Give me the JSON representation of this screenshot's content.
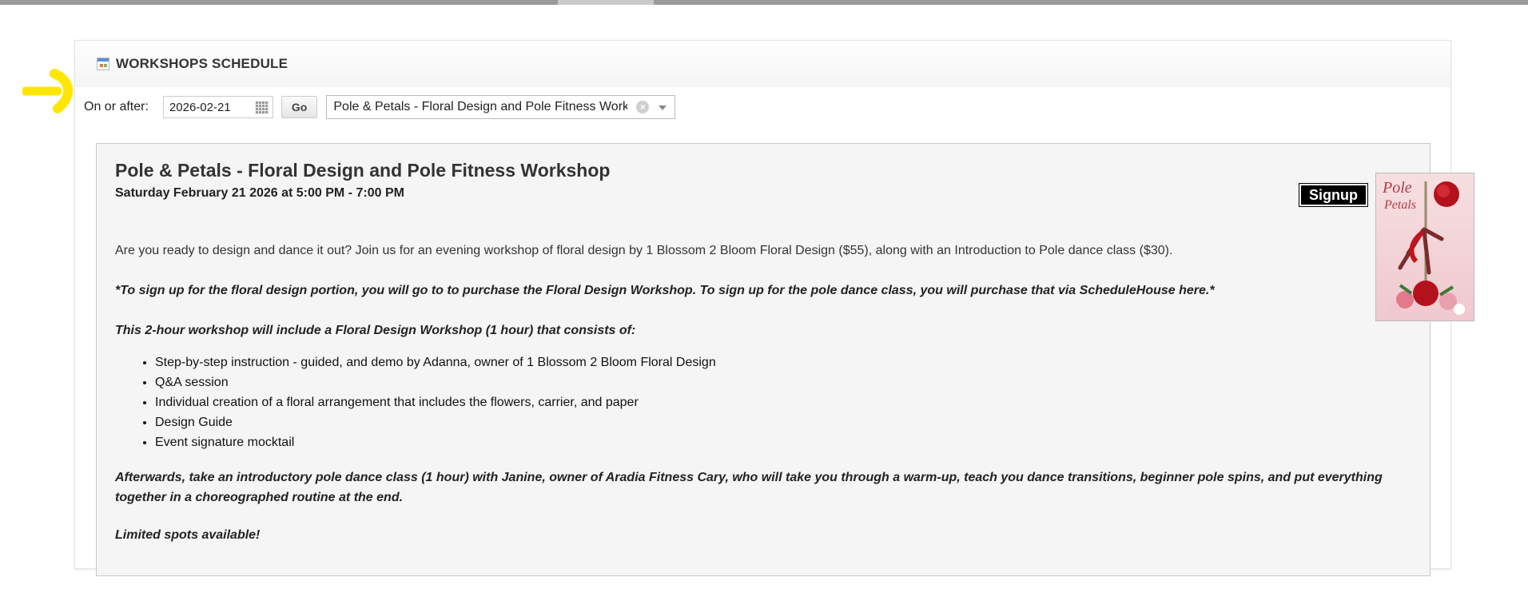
{
  "panel": {
    "title": "WORKSHOPS SCHEDULE"
  },
  "filter": {
    "label": "On or after:",
    "date_value": "2026-02-21",
    "go_label": "Go",
    "selected_workshop": "Pole & Petals - Floral Design and Pole Fitness Workshop"
  },
  "event": {
    "title": "Pole & Petals - Floral Design and Pole Fitness Workshop",
    "datetime": "Saturday February 21 2026 at 5:00 PM - 7:00 PM",
    "signup_label": "Signup",
    "poster_text": {
      "line1": "Pole",
      "line2": "Petals"
    },
    "intro": "Are you ready to design and dance it out?  Join us for an evening workshop of floral design by 1 Blossom 2 Bloom Floral Design ($55), along with an Introduction to Pole dance class ($30).",
    "signup_note": "*To sign up for the floral design portion, you will go to to purchase the Floral Design Workshop.  To sign up for the pole dance class, you will purchase that via ScheduleHouse here.*",
    "includes_heading": "This 2-hour workshop will include a Floral Design Workshop (1 hour) that consists of:",
    "includes": [
      "Step-by-step instruction - guided, and demo by Adanna, owner of 1 Blossom 2 Bloom Floral Design",
      "Q&A session",
      "Individual creation of a floral arrangement that includes the flowers, carrier, and paper",
      "Design Guide",
      "Event signature mocktail"
    ],
    "afterwards": "Afterwards, take an introductory pole dance class (1 hour) with Janine, owner of Aradia Fitness Cary, who will take you through a warm-up, teach you dance transitions, beginner pole spins, and put everything together in a choreographed routine at the end.",
    "limited": "Limited spots available!"
  }
}
